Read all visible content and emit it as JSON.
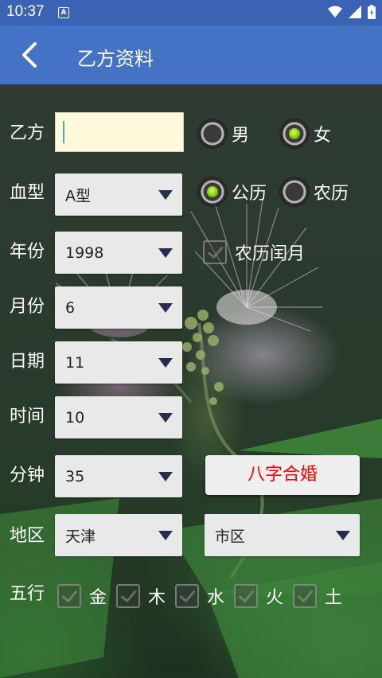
{
  "status_bar": {
    "time": "10:37",
    "notification_glyph": "A"
  },
  "app_bar": {
    "title": "乙方资料"
  },
  "form": {
    "name_label": "乙方",
    "name_value": "",
    "gender": {
      "male_label": "男",
      "female_label": "女",
      "selected": "女"
    },
    "blood_label": "血型",
    "blood_value": "A型",
    "calendar": {
      "solar_label": "公历",
      "lunar_label": "农历",
      "selected": "公历"
    },
    "year_label": "年份",
    "year_value": "1998",
    "leap_month_label": "农历闰月",
    "month_label": "月份",
    "month_value": "6",
    "day_label": "日期",
    "day_value": "11",
    "hour_label": "时间",
    "hour_value": "10",
    "minute_label": "分钟",
    "minute_value": "35",
    "bazi_button": "八字合婚",
    "region_label": "地区",
    "province_value": "天津",
    "city_value": "市区",
    "elements_label": "五行",
    "elements": [
      "金",
      "木",
      "水",
      "火",
      "土"
    ]
  },
  "colors": {
    "status_bar": "#3b63b3",
    "app_bar": "#4472c4",
    "button_text": "#ff0000",
    "radio_selected": "#7ec400",
    "text_field": "#fdfbdc"
  }
}
